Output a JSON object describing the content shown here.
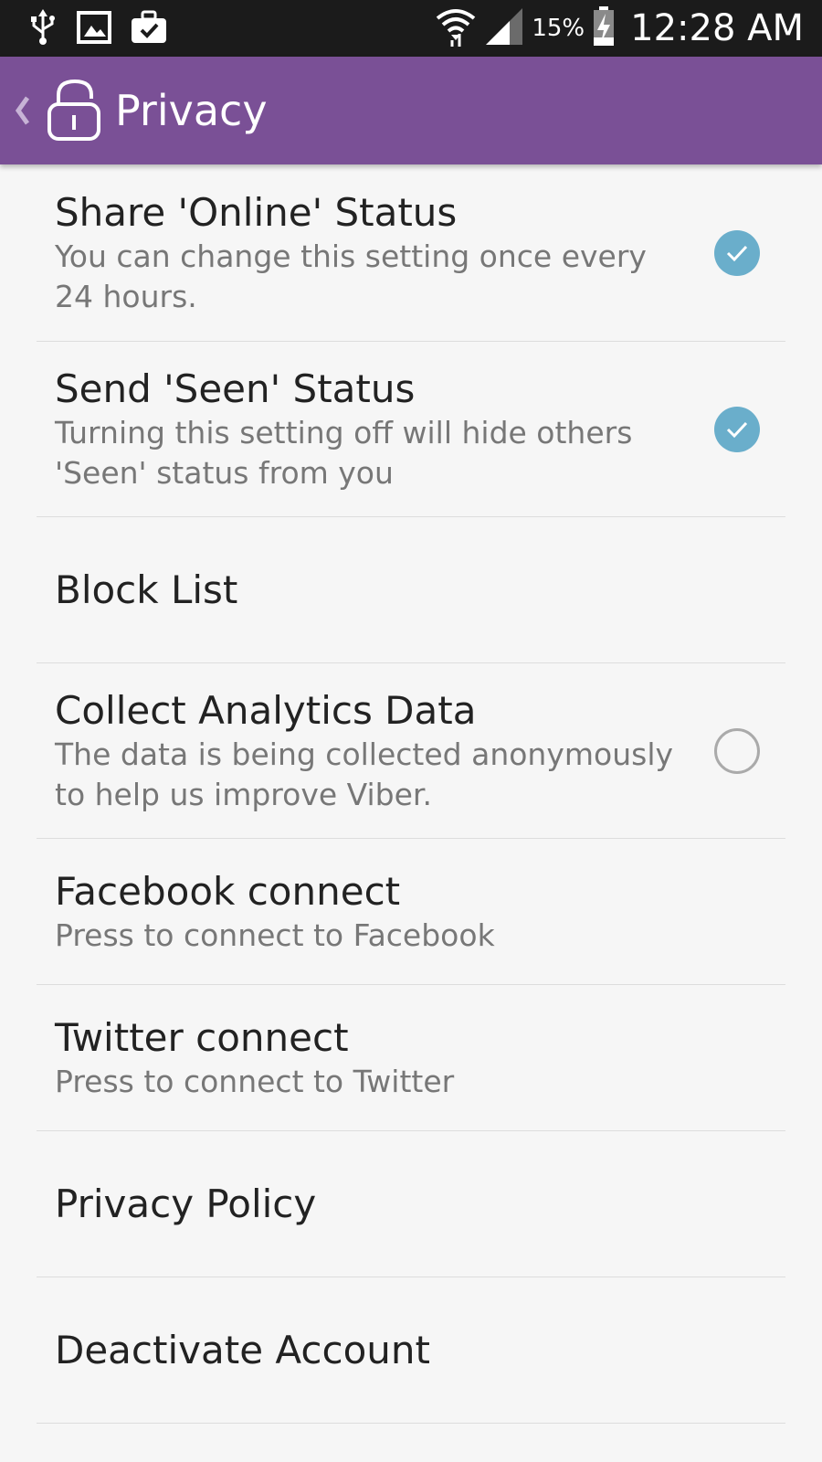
{
  "status_bar": {
    "battery_percent": "15%",
    "time": "12:28 AM",
    "icons": [
      "usb-icon",
      "image-icon",
      "briefcase-check-icon",
      "wifi-icon",
      "signal-icon",
      "battery-icon"
    ]
  },
  "action_bar": {
    "title": "Privacy",
    "color": "#7a5096"
  },
  "settings": [
    {
      "title": "Share 'Online' Status",
      "subtitle": "You can change this setting once every 24 hours.",
      "checkbox": true,
      "checked": true
    },
    {
      "title": "Send 'Seen' Status",
      "subtitle": "Turning this setting off will hide others 'Seen' status from you",
      "checkbox": true,
      "checked": true
    },
    {
      "title": "Block List"
    },
    {
      "title": "Collect Analytics Data",
      "subtitle": "The data is being collected anonymously to help us improve Viber.",
      "checkbox": true,
      "checked": false
    },
    {
      "title": "Facebook connect",
      "subtitle": "Press to connect to Facebook"
    },
    {
      "title": "Twitter connect",
      "subtitle": "Press to connect to Twitter"
    },
    {
      "title": "Privacy Policy"
    },
    {
      "title": "Deactivate Account"
    }
  ],
  "colors": {
    "check_on": "#6aaecb",
    "check_off_border": "#aaaaaa"
  }
}
